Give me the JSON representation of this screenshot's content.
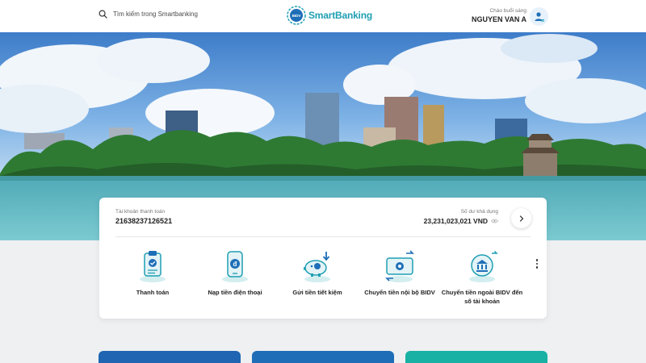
{
  "header": {
    "search_placeholder": "Tìm kiếm trong Smartbanking",
    "logo_text": "SmartBanking",
    "logo_badge": "BIDV",
    "greeting": "Chào buổi sáng",
    "user_name": "NGUYEN VAN A"
  },
  "hero": {
    "slide_count": 7,
    "active_slide": 2
  },
  "account": {
    "label": "Tài khoản thanh toán",
    "number": "21638237126521",
    "balance_label": "Số dư khả dụng",
    "balance": "23,231,023,021 VND"
  },
  "services": [
    {
      "label": "Thanh toán",
      "icon": "clipboard-check-icon"
    },
    {
      "label": "Nạp tiền điện thoại",
      "icon": "phone-topup-icon"
    },
    {
      "label": "Gửi tiền tiết kiệm",
      "icon": "piggy-bank-icon"
    },
    {
      "label": "Chuyển tiền nội bộ BIDV",
      "icon": "internal-transfer-icon"
    },
    {
      "label": "Chuyển tiền ngoài BIDV đến số tài khoản",
      "icon": "external-transfer-icon"
    }
  ],
  "colors": {
    "brand_teal": "#1f9fb3",
    "tile_1": "#1f65b2",
    "tile_2": "#1f6db7",
    "tile_3": "#18b1a4"
  }
}
